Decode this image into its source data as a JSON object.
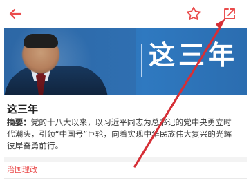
{
  "topbar": {
    "back_icon": "back-arrow-icon",
    "favorite_icon": "star-icon",
    "share_icon": "share-external-icon"
  },
  "banner": {
    "title": "这三年"
  },
  "article": {
    "title": "这三年",
    "summary_label": "摘要：",
    "summary_text": "党的十八大以来，以习近平同志为总书记的党中央勇立时代潮头，引领“中国号”巨轮，向着实现中华民族伟大复兴的光辉彼岸奋勇前行。"
  },
  "tag": {
    "label": "治国理政"
  },
  "colors": {
    "accent": "#ea4b4b",
    "banner_blue": "#2c71b7"
  }
}
